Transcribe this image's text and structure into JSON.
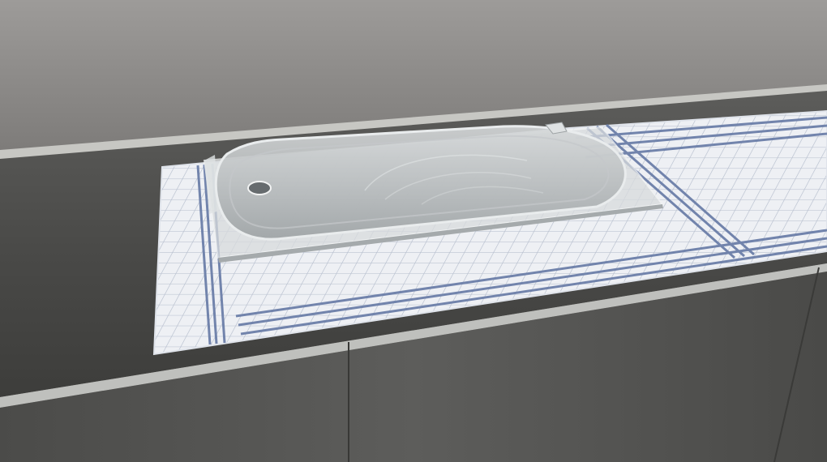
{
  "scene": {
    "subject": "glass-plate-on-dish-towel",
    "colors": {
      "wall": "#8c8a88",
      "countertop": "#4f4f4d",
      "countertop_edge": "#c9c9c5",
      "cabinet": "#555553",
      "towel_base": "#eef0f4",
      "towel_grid": "#b7bfd0",
      "towel_stripe": "#6c7fa9",
      "glass_plate": "#b9bcbd",
      "glass_tray": "#d7dadb"
    }
  }
}
